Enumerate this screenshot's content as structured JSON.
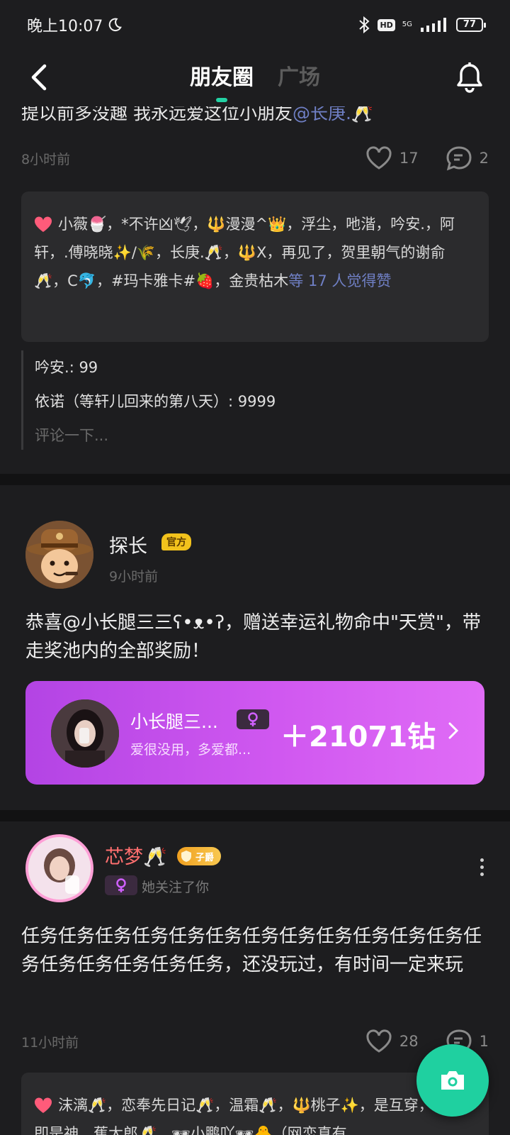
{
  "status_bar": {
    "time": "晚上10:07",
    "battery": "77"
  },
  "nav": {
    "tabs": [
      {
        "label": "朋友圈",
        "active": true
      },
      {
        "label": "广场",
        "active": false
      }
    ]
  },
  "post1": {
    "text_prefix": "提以前多没趣 我永远爱这位小朋友",
    "mention": "@长庚.🥂",
    "time": "8小时前",
    "likes_count": "17",
    "comments_count": "2",
    "likers_text": "小薇🍧，*不许凶🕊，🔱漫漫^👑，浮尘，吔湝，吟安.，阿轩，.傅晓晓✨/🌾，长庚.🥂，🔱X，再见了，贺里朝气的谢俞🥂，C🐬，#玛卡雅卡#🍓，金贵枯木",
    "likers_more": "等 17 人觉得赞",
    "comments": [
      {
        "author": "吟安.",
        "text": ": 99"
      },
      {
        "author": "依诺（等轩儿回来的第八天）",
        "text": ": 9999"
      }
    ],
    "comment_placeholder": "评论一下..."
  },
  "post2": {
    "author": "探长",
    "badge": "官方",
    "time": "9小时前",
    "text": "恭喜@小长腿三三ʕ•ᴥ•ʔ，赠送幸运礼物命中\"天赏\"，带走奖池内的全部奖励！",
    "prize": {
      "name": "小长腿三...",
      "signature": "爱很没用，多爱都...",
      "amount": "＋21071钻"
    }
  },
  "post3": {
    "author": "芯梦🥂",
    "title_badge": "子爵",
    "follow_text": "她关注了你",
    "text": "任务任务任务任务任务任务任务任务任务任务任务任务任务任务任务任务任务任务，还没玩过，有时间一定来玩",
    "time": "11小时前",
    "likes_count": "28",
    "comments_count": "1",
    "likers_text": "沫漓🥂，恋奉先日记🥂，温霜🥂，🔱桃子✨，是互穿，🔱劫即是神，蕉太郎🥂，🕶小鹏吖🕶🐥（网恋真有"
  },
  "colors": {
    "accent": "#23d2a4",
    "mention": "#6f7fc4",
    "prize_gradient_start": "#b344e4",
    "prize_gradient_end": "#e06cf6",
    "username_highlight": "#ff6f6f"
  },
  "icons": [
    "back-arrow-icon",
    "bell-icon",
    "heart-icon",
    "comment-icon",
    "camera-icon",
    "female-icon",
    "more-vertical-icon",
    "chevron-right-icon",
    "bluetooth-icon",
    "moon-icon",
    "signal-icon"
  ]
}
